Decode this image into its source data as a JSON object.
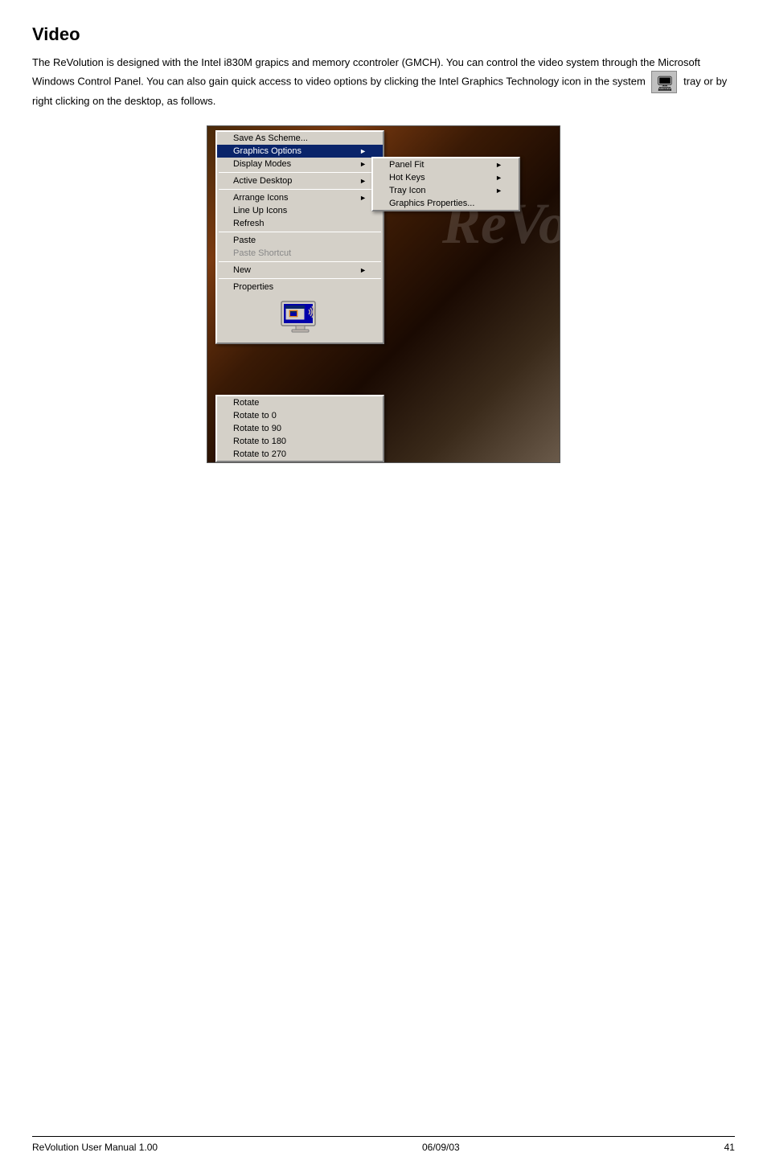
{
  "page": {
    "title": "Video",
    "intro_paragraph": "The ReVolution is designed with the Intel i830M grapics and memory ccontroler (GMCH). You can control the video system through the Microsoft Windows Control Panel. You can also gain quick access to video options by clicking the Intel Graphics Technology icon in the system",
    "intro_suffix": "tray or by right clicking on the desktop, as follows."
  },
  "context_menu_main": {
    "items": [
      {
        "label": "Save As Scheme...",
        "type": "item",
        "has_arrow": false,
        "disabled": false
      },
      {
        "label": "Graphics Options",
        "type": "item",
        "has_arrow": true,
        "disabled": false,
        "highlighted": true
      },
      {
        "label": "Display Modes",
        "type": "item",
        "has_arrow": true,
        "disabled": false
      },
      {
        "label": "",
        "type": "separator"
      },
      {
        "label": "Active Desktop",
        "type": "item",
        "has_arrow": true,
        "disabled": false
      },
      {
        "label": "",
        "type": "separator"
      },
      {
        "label": "Arrange Icons",
        "type": "item",
        "has_arrow": true,
        "disabled": false
      },
      {
        "label": "Line Up Icons",
        "type": "item",
        "has_arrow": false,
        "disabled": false
      },
      {
        "label": "Refresh",
        "type": "item",
        "has_arrow": false,
        "disabled": false
      },
      {
        "label": "",
        "type": "separator"
      },
      {
        "label": "Paste",
        "type": "item",
        "has_arrow": false,
        "disabled": false
      },
      {
        "label": "Paste Shortcut",
        "type": "item",
        "has_arrow": false,
        "disabled": true
      },
      {
        "label": "",
        "type": "separator"
      },
      {
        "label": "New",
        "type": "item",
        "has_arrow": true,
        "disabled": false
      },
      {
        "label": "",
        "type": "separator"
      },
      {
        "label": "Properties",
        "type": "item",
        "has_arrow": false,
        "disabled": false
      }
    ]
  },
  "context_menu_sub": {
    "items": [
      {
        "label": "Panel Fit",
        "type": "item",
        "has_arrow": true,
        "disabled": false
      },
      {
        "label": "Hot Keys",
        "type": "item",
        "has_arrow": true,
        "disabled": false
      },
      {
        "label": "Tray Icon",
        "type": "item",
        "has_arrow": true,
        "disabled": false
      },
      {
        "label": "Graphics Properties...",
        "type": "item",
        "has_arrow": false,
        "disabled": false
      }
    ]
  },
  "rotate_section": {
    "items": [
      {
        "label": "Rotate",
        "type": "item",
        "has_arrow": false,
        "disabled": false
      },
      {
        "label": "Rotate to 0",
        "type": "item",
        "has_arrow": false,
        "disabled": false
      },
      {
        "label": "Rotate to 90",
        "type": "item",
        "has_arrow": false,
        "disabled": false
      },
      {
        "label": "Rotate to 180",
        "type": "item",
        "has_arrow": false,
        "disabled": false
      },
      {
        "label": "Rotate to 270",
        "type": "item",
        "has_arrow": false,
        "disabled": false
      }
    ]
  },
  "footer": {
    "left": "ReVolution User Manual 1.00",
    "center": "06/09/03",
    "right": "41"
  }
}
